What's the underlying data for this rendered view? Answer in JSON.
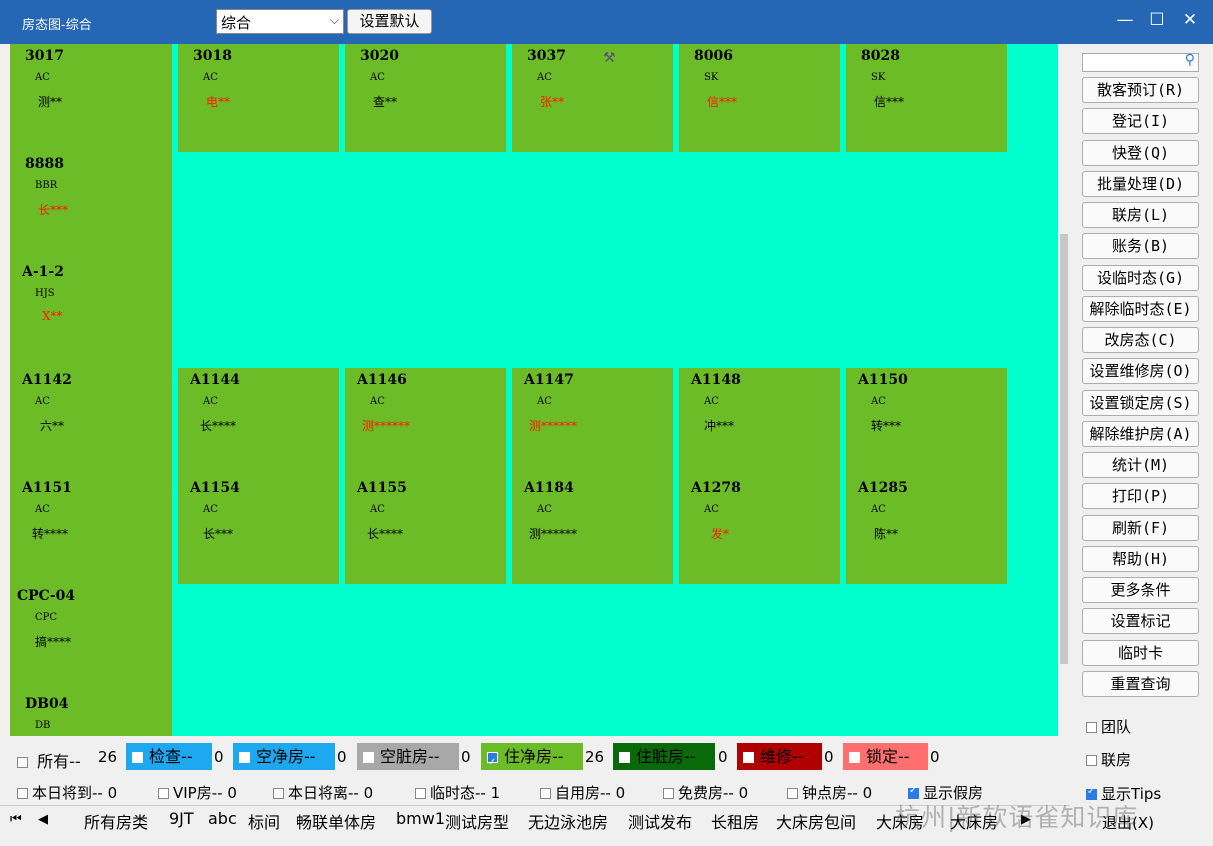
{
  "window": {
    "title": "房态图-综合",
    "view_select": "综合",
    "set_default_label": "设置默认",
    "min_glyph": "—",
    "max_glyph": "☐",
    "close_glyph": "✕"
  },
  "rooms": {
    "r3017": {
      "num": "3017",
      "type": "AC",
      "guest": "测**"
    },
    "r3018": {
      "num": "3018",
      "type": "AC",
      "guest": "电**"
    },
    "r3020": {
      "num": "3020",
      "type": "AC",
      "guest": "查**"
    },
    "r3037": {
      "num": "3037",
      "type": "AC",
      "guest": "张**"
    },
    "r8006": {
      "num": "8006",
      "type": "SK",
      "guest": "信***"
    },
    "r8028": {
      "num": "8028",
      "type": "SK",
      "guest": "信***"
    },
    "r8888": {
      "num": "8888",
      "type": "BBR",
      "guest": "长***"
    },
    "rA12": {
      "num": "A-1-2",
      "type": "HJS",
      "guest": "X**"
    },
    "rA1142": {
      "num": "A1142",
      "type": "AC",
      "guest": "六**"
    },
    "rA1144": {
      "num": "A1144",
      "type": "AC",
      "guest": "长****"
    },
    "rA1146": {
      "num": "A1146",
      "type": "AC",
      "guest": "测******"
    },
    "rA1147": {
      "num": "A1147",
      "type": "AC",
      "guest": "测******"
    },
    "rA1148": {
      "num": "A1148",
      "type": "AC",
      "guest": "冲***"
    },
    "rA1150": {
      "num": "A1150",
      "type": "AC",
      "guest": "转***"
    },
    "rA1151": {
      "num": "A1151",
      "type": "AC",
      "guest": "转****"
    },
    "rA1154": {
      "num": "A1154",
      "type": "AC",
      "guest": "长***"
    },
    "rA1155": {
      "num": "A1155",
      "type": "AC",
      "guest": "长****"
    },
    "rA1184": {
      "num": "A1184",
      "type": "AC",
      "guest": "测******"
    },
    "rA1278": {
      "num": "A1278",
      "type": "AC",
      "guest": "发*"
    },
    "rA1285": {
      "num": "A1285",
      "type": "AC",
      "guest": "陈**"
    },
    "rCPC04": {
      "num": "CPC-04",
      "type": "CPC",
      "guest": "搞****"
    },
    "rDB04": {
      "num": "DB04",
      "type": "DB",
      "guest": ""
    }
  },
  "actions": [
    "散客预订(R)",
    "登记(I)",
    "快登(Q)",
    "批量处理(D)",
    "联房(L)",
    "账务(B)",
    "设临时态(G)",
    "解除临时态(E)",
    "改房态(C)",
    "设置维修房(O)",
    "设置锁定房(S)",
    "解除维护房(A)",
    "统计(M)",
    "打印(P)",
    "刷新(F)",
    "帮助(H)",
    "更多条件",
    "设置标记",
    "临时卡",
    "重置查询"
  ],
  "right_checks": {
    "team": "团队",
    "linked": "联房",
    "tips": "显示Tips"
  },
  "legend": {
    "all": {
      "label": "所有--",
      "count": "26"
    },
    "inspect": {
      "label": "检查--",
      "count": "0",
      "color": "#1ea8f0"
    },
    "vacant_clean": {
      "label": "空净房--",
      "count": "0",
      "color": "#1ea8f0"
    },
    "vacant_dirty": {
      "label": "空脏房--",
      "count": "0",
      "color": "#a8a8a8"
    },
    "occ_clean": {
      "label": "住净房--",
      "count": "26",
      "color": "#6cbc27"
    },
    "occ_dirty": {
      "label": "住脏房--",
      "count": "0",
      "color": "#0a6a0a"
    },
    "repair": {
      "label": "维修--",
      "count": "0",
      "color": "#b00000"
    },
    "locked": {
      "label": "锁定--",
      "count": "0",
      "color": "#ff6f6f"
    }
  },
  "filters": {
    "arrive": "本日将到-- 0",
    "vip": "VIP房-- 0",
    "depart": "本日将离-- 0",
    "temp": "临时态-- 1",
    "self_use": "自用房-- 0",
    "free": "免费房-- 0",
    "hourly": "钟点房-- 0",
    "show_fake": "显示假房"
  },
  "tabs": [
    "所有房类",
    "9JT",
    "abc",
    "标间",
    "畅联单体房",
    "bmw1",
    "测试房型",
    "无边泳池房",
    "测试发布",
    "长租房",
    "大床房包间",
    "大床房",
    "大床房"
  ],
  "nav": {
    "first": "⏮",
    "prev": "◀",
    "next": "▶"
  },
  "watermark": "杭州|新软语雀知识库",
  "exit_label": "退出(X)",
  "search_icon": "search-icon"
}
